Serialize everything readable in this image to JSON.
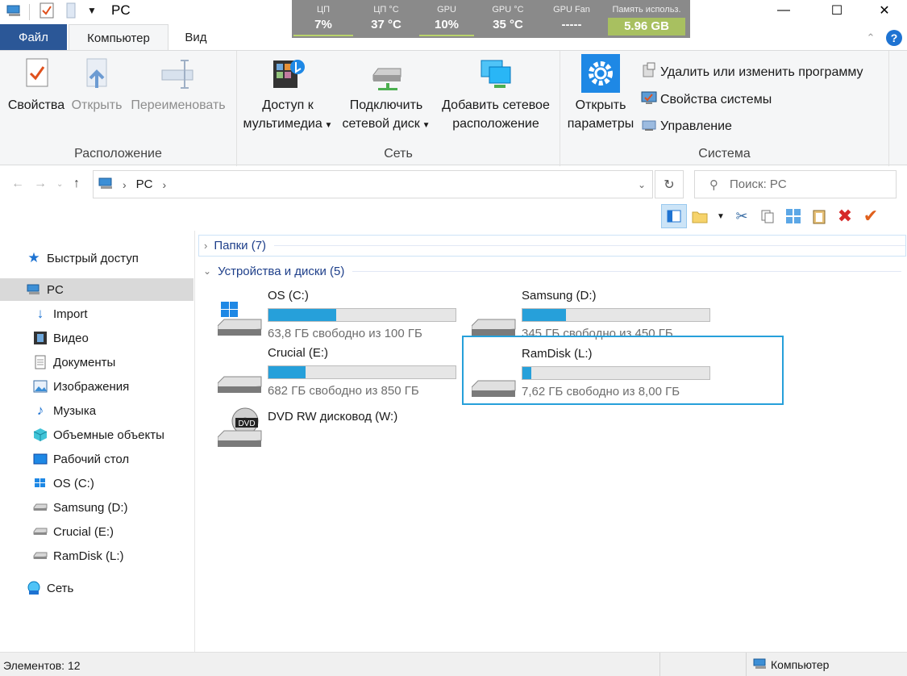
{
  "window": {
    "title": "PC",
    "minimize_glyph": "—",
    "maximize_glyph": "☐",
    "close_glyph": "✕"
  },
  "hw_monitor": {
    "cells": [
      {
        "label": "ЦП",
        "value": "7%"
      },
      {
        "label": "ЦП °C",
        "value": "37 °C"
      },
      {
        "label": "GPU",
        "value": "10%"
      },
      {
        "label": "GPU °C",
        "value": "35 °C"
      },
      {
        "label": "GPU Fan",
        "value": "-----"
      },
      {
        "label": "Память использ.",
        "value": "5.96 GB"
      }
    ]
  },
  "ribbon": {
    "tabs": {
      "file": "Файл",
      "computer": "Компьютер",
      "view": "Вид"
    },
    "location": {
      "label": "Расположение",
      "properties": "Свойства",
      "open": "Открыть",
      "rename": "Переименовать"
    },
    "network": {
      "label": "Сеть",
      "media_line1": "Доступ к",
      "media_line2": "мультимедиа",
      "map_line1": "Подключить",
      "map_line2": "сетевой диск",
      "add_line1": "Добавить сетевое",
      "add_line2": "расположение"
    },
    "system": {
      "label": "Система",
      "open_line1": "Открыть",
      "open_line2": "параметры",
      "uninstall": "Удалить или изменить программу",
      "sys_props": "Свойства системы",
      "manage": "Управление"
    }
  },
  "address": {
    "path_root": "PC",
    "sep": "›",
    "search_placeholder": "Поиск: PC"
  },
  "nav": {
    "items": [
      {
        "label": "Быстрый доступ"
      },
      {
        "label": "PC"
      },
      {
        "label": "Import"
      },
      {
        "label": "Видео"
      },
      {
        "label": "Документы"
      },
      {
        "label": "Изображения"
      },
      {
        "label": "Музыка"
      },
      {
        "label": "Объемные объекты"
      },
      {
        "label": "Рабочий стол"
      },
      {
        "label": "OS (C:)"
      },
      {
        "label": "Samsung (D:)"
      },
      {
        "label": "Crucial (E:)"
      },
      {
        "label": "RamDisk (L:)"
      },
      {
        "label": "Сеть"
      }
    ]
  },
  "content": {
    "folders_group": "Папки (7)",
    "devices_group": "Устройства и диски (5)",
    "drives": [
      {
        "name": "OS (C:)",
        "free": "63,8 ГБ свободно из 100 ГБ",
        "used_fraction": 0.362,
        "icon": "windows-drive-icon"
      },
      {
        "name": "Samsung (D:)",
        "free": "345 ГБ свободно из 450 ГБ",
        "used_fraction": 0.233,
        "icon": "hdd-icon"
      },
      {
        "name": "Crucial (E:)",
        "free": "682 ГБ свободно из 850 ГБ",
        "used_fraction": 0.198,
        "icon": "hdd-icon"
      },
      {
        "name": "RamDisk (L:)",
        "free": "7,62 ГБ свободно из 8,00 ГБ",
        "used_fraction": 0.048,
        "icon": "hdd-icon"
      },
      {
        "name": "DVD RW дисковод (W:)",
        "icon": "dvd-drive-icon",
        "dvd_badge": "DVD"
      }
    ]
  },
  "status": {
    "items_count": "Элементов: 12",
    "location": "Компьютер"
  },
  "colors": {
    "accent": "#26a0da",
    "file_tab": "#2b5797"
  }
}
